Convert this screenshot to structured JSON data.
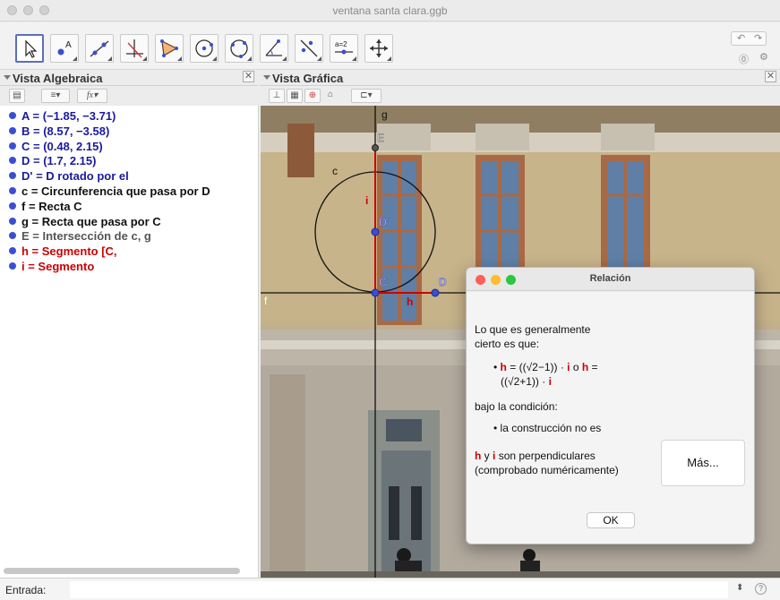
{
  "window": {
    "title": "ventana santa clara.ggb"
  },
  "toolbar": {
    "tools": [
      "move-tool",
      "point-tool",
      "line-tool",
      "perpendicular-line-tool",
      "polygon-tool",
      "circle-center-point-tool",
      "circle-three-points-tool",
      "angle-tool",
      "reflect-tool",
      "slider-tool",
      "move-graphics-view-tool"
    ],
    "slider_label": "a=2"
  },
  "algebra": {
    "title": "Vista Algebraica",
    "items": [
      {
        "text": "A = (−1.85, −3.71)",
        "color": "#1a1a9c"
      },
      {
        "text": "B = (8.57, −3.58)",
        "color": "#1a1a9c"
      },
      {
        "text": "C = (0.48, 2.15)",
        "color": "#1a1a9c"
      },
      {
        "text": "D = (1.7, 2.15)",
        "color": "#1a1a9c"
      },
      {
        "text": "D' = D rotado por el",
        "color": "#1a1a9c"
      },
      {
        "text": "c = Circunferencia que pasa por D",
        "color": "#111111"
      },
      {
        "text": "f = Recta C",
        "color": "#111111"
      },
      {
        "text": "g = Recta que pasa por C",
        "color": "#111111"
      },
      {
        "text": "E = Intersección de c, g",
        "color": "#555555"
      },
      {
        "text": "h = Segmento [C,",
        "color": "#cc0000"
      },
      {
        "text": "i = Segmento",
        "color": "#cc0000"
      }
    ],
    "fx_label": "fx"
  },
  "graphics": {
    "title": "Vista Gráfica",
    "labels": {
      "g": "g",
      "E": "E",
      "c": "c",
      "i": "i",
      "Dp": "D'",
      "C": "C",
      "D": "D",
      "h": "h",
      "f": "f"
    }
  },
  "dialog": {
    "title": "Relación",
    "line1": "Lo que es generalmente",
    "line2": "cierto es que:",
    "formula_h1": "h",
    "formula_mid": " = ((√2−1)) · ",
    "formula_i1": "i",
    "formula_o": " o ",
    "formula_h2": "h",
    "formula_eq2": " =",
    "formula_line2": "((√2+1)) · ",
    "formula_i2": "i",
    "bajo": "bajo la condición:",
    "condition": "• la construcción no es",
    "perp_h": "h",
    "perp_y": " y ",
    "perp_i": "i",
    "perp_rest": " son perpendiculares",
    "perp_line2": "(comprobado numéricamente)",
    "more_button": "Más...",
    "ok_button": "OK",
    "bullet": "•"
  },
  "input_bar": {
    "label": "Entrada:",
    "value": "",
    "help": "?",
    "stepper": "⬍"
  },
  "colors": {
    "accent": "#5a6fb8",
    "red": "#cc0000",
    "point_blue": "#3a4fd0"
  }
}
